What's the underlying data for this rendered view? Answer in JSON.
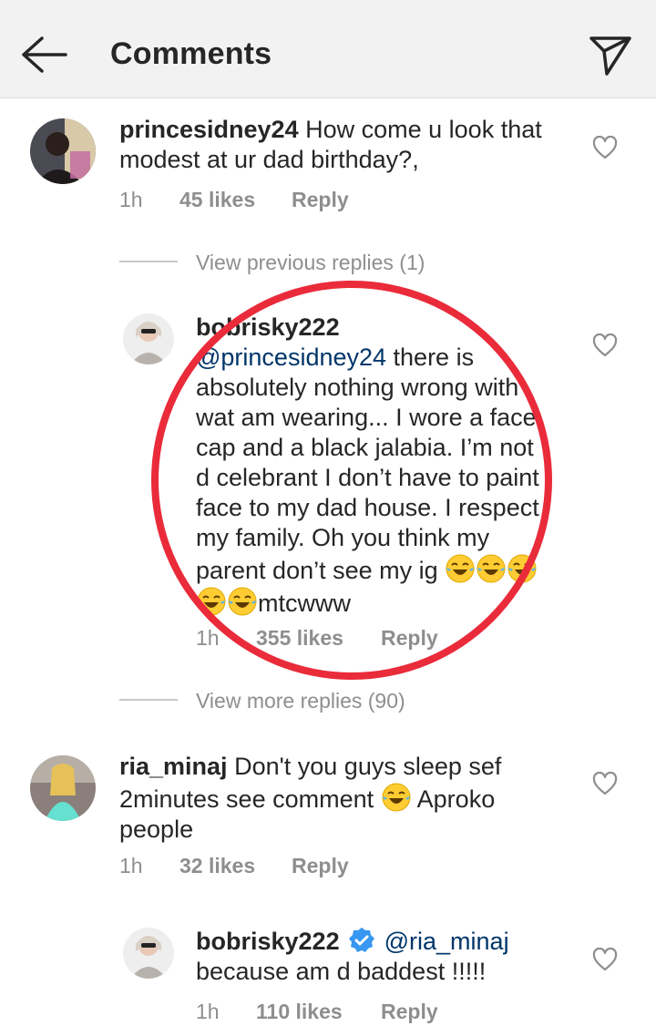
{
  "header": {
    "title": "Comments"
  },
  "colors": {
    "annotation_circle": "#ea2b3a",
    "mention": "#003569",
    "verified_badge": "#3897f0",
    "meta_text": "#8e8e8e"
  },
  "comments": [
    {
      "username": "princesidney24",
      "text": "How come u look that",
      "text_2": "modest at ur dad birthday?,",
      "time": "1h",
      "likes": "45 likes",
      "reply_label": "Reply",
      "avatar_icon": "user-avatar"
    },
    {
      "username": "bobrisky222",
      "mention": "@princesidney24",
      "line1_rest": " there is",
      "lines": [
        "absolutely nothing wrong with",
        "wat am wearing... I wore a face",
        "cap and a black jalabia. I’m not",
        "d celebrant I don’t have to paint",
        "face to my dad house. I respect",
        "my family. Oh you think my"
      ],
      "line8": "parent don’t see my ig",
      "line9_rest": "mtcwww",
      "time": "1h",
      "likes": "355 likes",
      "reply_label": "Reply",
      "avatar_icon": "user-avatar"
    },
    {
      "username": "ria_minaj",
      "text": "Don't you guys sleep sef",
      "text_2a": "2minutes see comment",
      "text_2b": "Aproko",
      "text_3": "people",
      "time": "1h",
      "likes": "32 likes",
      "reply_label": "Reply",
      "avatar_icon": "user-avatar"
    },
    {
      "username": "bobrisky222",
      "mention": "@ria_minaj",
      "text_2": "because am d baddest !!!!!",
      "time": "1h",
      "likes": "110 likes",
      "reply_label": "Reply",
      "avatar_icon": "user-avatar"
    }
  ],
  "threads": {
    "previous_replies": "View previous replies (1)",
    "more_replies": "View more replies (90)"
  },
  "emoji": {
    "tears_of_joy": "face-with-tears-of-joy"
  }
}
